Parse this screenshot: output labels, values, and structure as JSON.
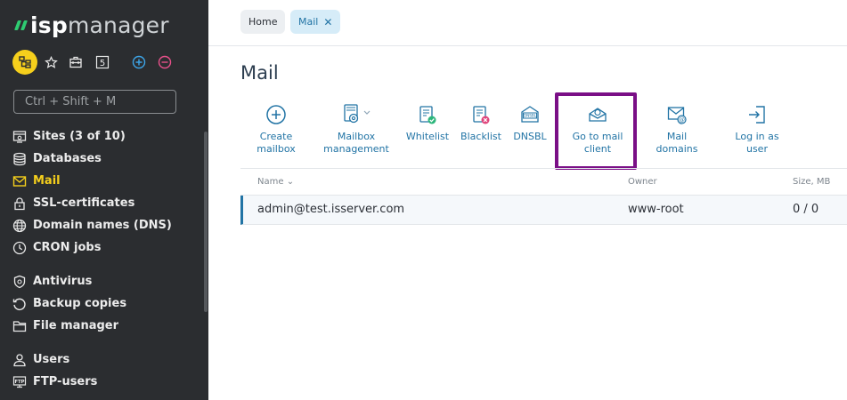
{
  "brand": {
    "prefix": "isp",
    "name": "manager"
  },
  "quick_bar": {
    "counter": "5"
  },
  "search": {
    "placeholder": "Ctrl + Shift + M"
  },
  "sidebar": {
    "group1": [
      {
        "label": "Sites (3 of 10)",
        "icon": "sites-icon"
      },
      {
        "label": "Databases",
        "icon": "database-icon"
      },
      {
        "label": "Mail",
        "icon": "mail-icon",
        "active": true
      },
      {
        "label": "SSL-certificates",
        "icon": "lock-icon"
      },
      {
        "label": "Domain names (DNS)",
        "icon": "globe-icon"
      },
      {
        "label": "CRON jobs",
        "icon": "clock-icon"
      }
    ],
    "group2": [
      {
        "label": "Antivirus",
        "icon": "shield-icon"
      },
      {
        "label": "Backup copies",
        "icon": "backup-icon"
      },
      {
        "label": "File manager",
        "icon": "folder-icon"
      }
    ],
    "group3": [
      {
        "label": "Users",
        "icon": "user-icon"
      },
      {
        "label": "FTP-users",
        "icon": "ftp-icon"
      }
    ]
  },
  "tabs": {
    "home": "Home",
    "mail": "Mail"
  },
  "page": {
    "title": "Mail"
  },
  "toolbar": {
    "create_mailbox": {
      "line1": "Create",
      "line2": "mailbox"
    },
    "mailbox_management": {
      "line1": "Mailbox",
      "line2": "management"
    },
    "whitelist": "Whitelist",
    "blacklist": "Blacklist",
    "dnsbl": "DNSBL",
    "go_to_mail_client": {
      "line1": "Go to mail",
      "line2": "client"
    },
    "mail_domains": {
      "line1": "Mail",
      "line2": "domains"
    },
    "log_in_as_user": {
      "line1": "Log in as",
      "line2": "user"
    }
  },
  "table": {
    "headers": {
      "name": "Name",
      "owner": "Owner",
      "size": "Size, MB"
    },
    "rows": [
      {
        "name": "admin@test.isserver.com",
        "owner": "www-root",
        "size": "0 / 0"
      }
    ]
  },
  "colors": {
    "sidebar_bg": "#2b2d30",
    "accent": "#2274a5",
    "active_nav": "#f5cf1c",
    "highlight": "#7a0f86",
    "brand_green": "#2ecc71"
  }
}
